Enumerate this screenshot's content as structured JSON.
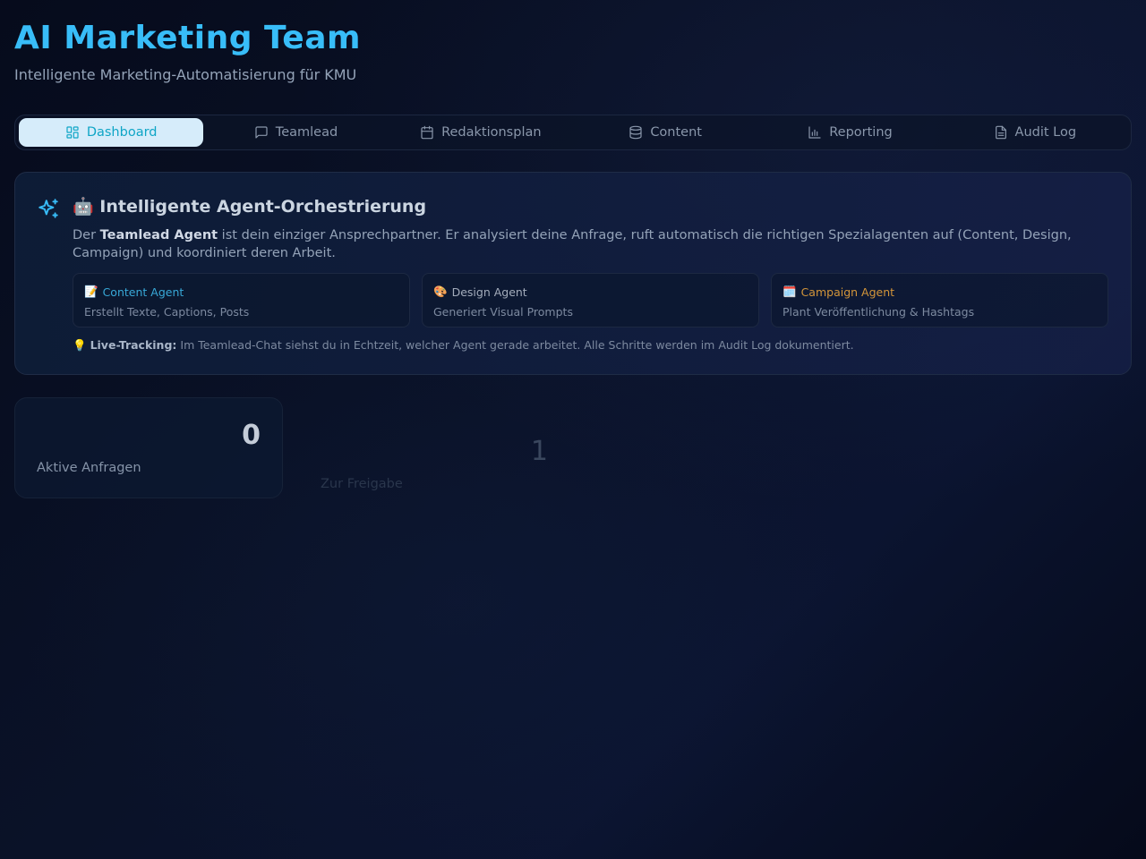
{
  "header": {
    "title": "AI Marketing Team",
    "subtitle": "Intelligente Marketing-Automatisierung für KMU"
  },
  "tabs": [
    {
      "label": "Dashboard",
      "icon": "dashboard-icon",
      "active": true
    },
    {
      "label": "Teamlead",
      "icon": "chat-icon",
      "active": false
    },
    {
      "label": "Redaktionsplan",
      "icon": "calendar-icon",
      "active": false
    },
    {
      "label": "Content",
      "icon": "database-icon",
      "active": false
    },
    {
      "label": "Reporting",
      "icon": "bar-chart-icon",
      "active": false
    },
    {
      "label": "Audit Log",
      "icon": "document-icon",
      "active": false
    }
  ],
  "info_card": {
    "icon": "sparkles-icon",
    "emoji": "🤖",
    "heading": "Intelligente Agent-Orchestrierung",
    "desc_prefix": "Der ",
    "desc_bold": "Teamlead Agent",
    "desc_rest": " ist dein einziger Ansprechpartner. Er analysiert deine Anfrage, ruft automatisch die richtigen Spezialagenten auf (Content, Design, Campaign) und koordiniert deren Arbeit.",
    "agents": [
      {
        "emoji": "📝",
        "name": "Content Agent",
        "desc": "Erstellt Texte, Captions, Posts",
        "color": "#38a9d8"
      },
      {
        "emoji": "🎨",
        "name": "Design Agent",
        "desc": "Generiert Visual Prompts",
        "color": "#a3acbb"
      },
      {
        "emoji": "🗓️",
        "name": "Campaign Agent",
        "desc": "Plant Veröffentlichung & Hashtags",
        "color": "#d3953a"
      }
    ],
    "tracking_emoji": "💡",
    "tracking_bold": "Live-Tracking:",
    "tracking_text": " Im Teamlead-Chat siehst du in Echtzeit, welcher Agent gerade arbeitet. Alle Schritte werden im Audit Log dokumentiert."
  },
  "stats": [
    {
      "value": "0",
      "label": "Aktive Anfragen"
    },
    {
      "value": "1",
      "label": "Zur Freigabe"
    }
  ],
  "colors": {
    "accent": "#38bdf8",
    "active_tab_bg": "#d6ecfa",
    "background": "#070d1f"
  }
}
